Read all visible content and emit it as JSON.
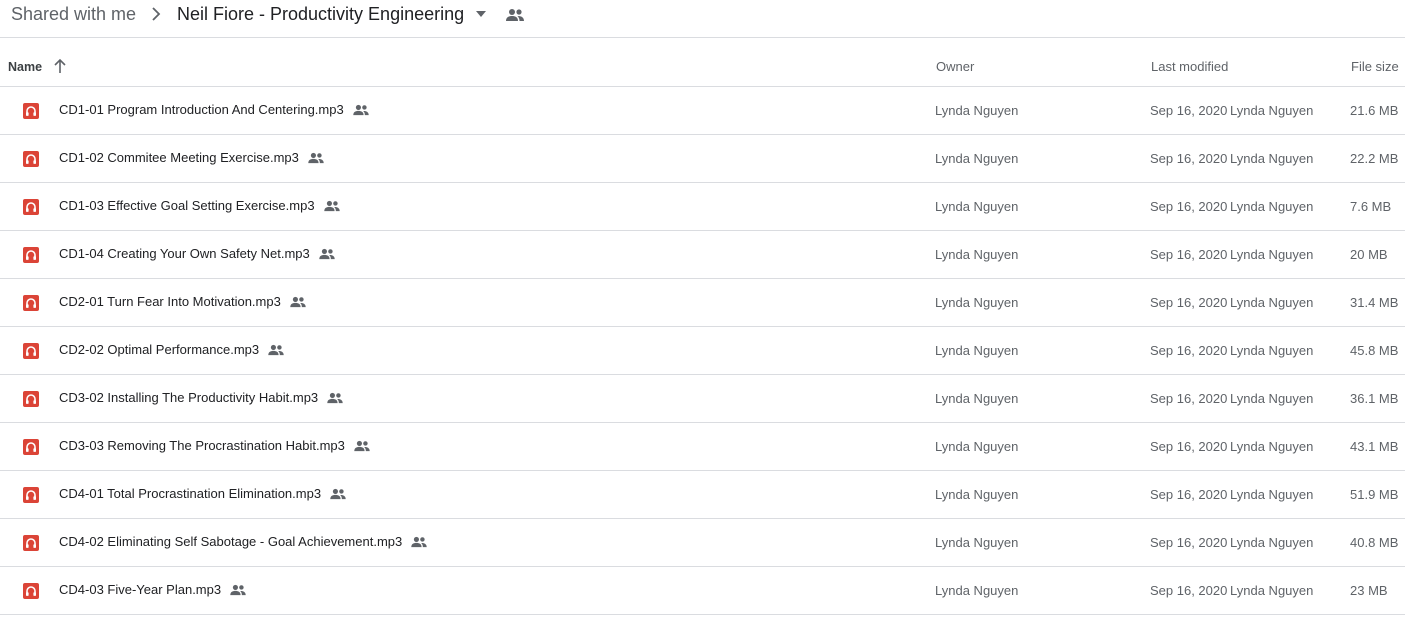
{
  "breadcrumb": {
    "root": "Shared with me",
    "current": "Neil Fiore - Productivity Engineering"
  },
  "columns": {
    "name": "Name",
    "owner": "Owner",
    "last_modified": "Last modified",
    "file_size": "File size",
    "sort_direction": "ascending"
  },
  "colors": {
    "audio_icon": "#db4437",
    "text_primary": "#202124",
    "text_secondary": "#5f6368",
    "divider": "#dadce0"
  },
  "icons": {
    "breadcrumb_separator": "chevron-right-icon",
    "folder_dropdown": "caret-down-icon",
    "shared_folder": "people-icon",
    "sort": "arrow-up-icon",
    "file_type": "audio-file-icon",
    "file_shared": "people-icon"
  },
  "files": [
    {
      "name": "CD1-01 Program Introduction And Centering.mp3",
      "owner": "Lynda Nguyen",
      "modified_date": "Sep 16, 2020",
      "modified_by": "Lynda Nguyen",
      "size": "21.6 MB"
    },
    {
      "name": "CD1-02 Commitee Meeting Exercise.mp3",
      "owner": "Lynda Nguyen",
      "modified_date": "Sep 16, 2020",
      "modified_by": "Lynda Nguyen",
      "size": "22.2 MB"
    },
    {
      "name": "CD1-03 Effective Goal Setting Exercise.mp3",
      "owner": "Lynda Nguyen",
      "modified_date": "Sep 16, 2020",
      "modified_by": "Lynda Nguyen",
      "size": "7.6 MB"
    },
    {
      "name": "CD1-04 Creating Your Own Safety Net.mp3",
      "owner": "Lynda Nguyen",
      "modified_date": "Sep 16, 2020",
      "modified_by": "Lynda Nguyen",
      "size": "20 MB"
    },
    {
      "name": "CD2-01 Turn Fear Into Motivation.mp3",
      "owner": "Lynda Nguyen",
      "modified_date": "Sep 16, 2020",
      "modified_by": "Lynda Nguyen",
      "size": "31.4 MB"
    },
    {
      "name": "CD2-02 Optimal Performance.mp3",
      "owner": "Lynda Nguyen",
      "modified_date": "Sep 16, 2020",
      "modified_by": "Lynda Nguyen",
      "size": "45.8 MB"
    },
    {
      "name": "CD3-02 Installing The Productivity Habit.mp3",
      "owner": "Lynda Nguyen",
      "modified_date": "Sep 16, 2020",
      "modified_by": "Lynda Nguyen",
      "size": "36.1 MB"
    },
    {
      "name": "CD3-03 Removing The Procrastination Habit.mp3",
      "owner": "Lynda Nguyen",
      "modified_date": "Sep 16, 2020",
      "modified_by": "Lynda Nguyen",
      "size": "43.1 MB"
    },
    {
      "name": "CD4-01 Total Procrastination Elimination.mp3",
      "owner": "Lynda Nguyen",
      "modified_date": "Sep 16, 2020",
      "modified_by": "Lynda Nguyen",
      "size": "51.9 MB"
    },
    {
      "name": "CD4-02 Eliminating Self Sabotage - Goal Achievement.mp3",
      "owner": "Lynda Nguyen",
      "modified_date": "Sep 16, 2020",
      "modified_by": "Lynda Nguyen",
      "size": "40.8 MB"
    },
    {
      "name": "CD4-03 Five-Year Plan.mp3",
      "owner": "Lynda Nguyen",
      "modified_date": "Sep 16, 2020",
      "modified_by": "Lynda Nguyen",
      "size": "23 MB"
    }
  ]
}
